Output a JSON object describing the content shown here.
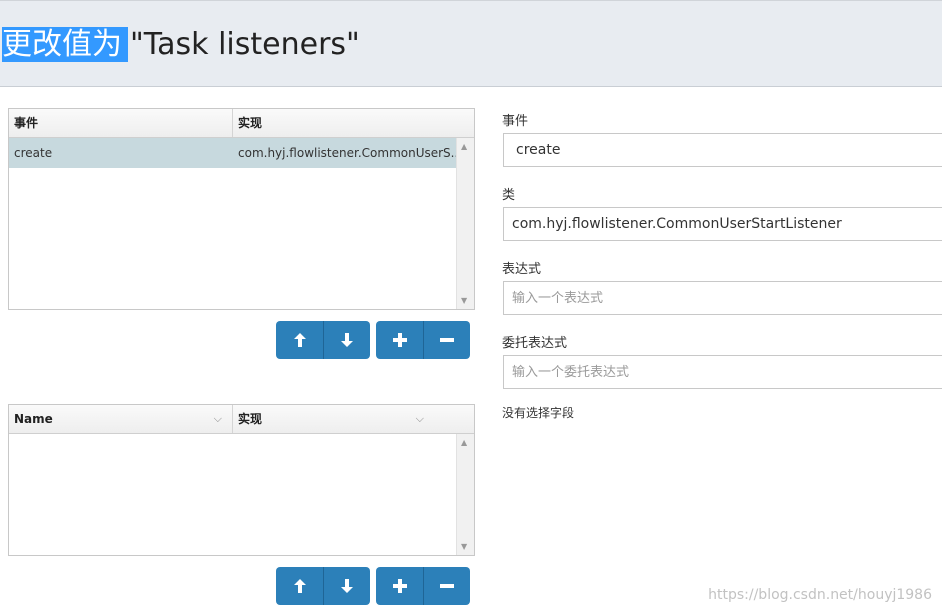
{
  "header": {
    "title_highlight": "更改值为",
    "title_rest": "\"Task listeners\""
  },
  "listeners_grid": {
    "columns": [
      "事件",
      "实现"
    ],
    "rows": [
      {
        "event": "create",
        "implementation": "com.hyj.flowlistener.CommonUserS..."
      }
    ]
  },
  "fields_grid": {
    "columns": [
      "Name",
      "实现"
    ]
  },
  "form": {
    "event_label": "事件",
    "event_value": "create",
    "class_label": "类",
    "class_value": "com.hyj.flowlistener.CommonUserStartListener",
    "expression_label": "表达式",
    "expression_placeholder": "输入一个表达式",
    "delegate_label": "委托表达式",
    "delegate_placeholder": "输入一个委托表达式",
    "no_field_selected": "没有选择字段"
  },
  "watermark": "https://blog.csdn.net/houyj1986",
  "colors": {
    "button": "#2c80b9",
    "selected_row": "#c7d9de",
    "header_bg": "#e8ecf1",
    "highlight": "#3399ff"
  },
  "icons": [
    "arrow-up-icon",
    "arrow-down-icon",
    "plus-icon",
    "minus-icon",
    "chevron-down-icon"
  ]
}
